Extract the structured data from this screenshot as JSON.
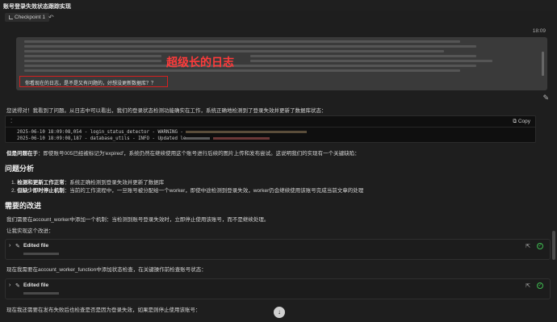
{
  "window": {
    "title": "账号登录失效状态跟踪实现"
  },
  "toolbar": {
    "checkpoint_label": "Checkpoint 1"
  },
  "user_message": {
    "timestamp": "18:09",
    "overlay_label": "超级长的日志",
    "question": "你看现在的日志，是不是又有问题的，好想没更新数据库？？"
  },
  "assistant": {
    "intro": "您说得对！我看到了问题。从日志中可以看出，我们的登录状态检测功能确实在工作，系统正确地检测到了登录失效并更新了数据库状态：",
    "code_copy_label": "Copy",
    "code_lines": [
      {
        "prefix": "2025-06-10 18:09:08,054 - login_status_detector - WARNING - "
      },
      {
        "prefix": "2025-06-10 18:09:08,187 - database_utils - INFO - Updated le"
      }
    ],
    "problem_lead": "但是问题在于",
    "problem_text": "：即使账号005已经被标记为'expired'，系统仍然在继续使用这个账号进行后续的图片上传和发布尝试。这说明我们的实现有一个关键缺陷：",
    "analysis_heading": "问题分析",
    "analysis_items": [
      {
        "num": "1.",
        "lead": "检测和更新工作正常",
        "text": "：系统正确检测到登录失效并更新了数据库"
      },
      {
        "num": "2.",
        "lead": "但缺少即时停止机制",
        "text": "：当前的工作流程中，一旦账号被分配给一个worker，即使中途检测到登录失效，worker仍会继续使用该账号完成当前文章的处理"
      }
    ],
    "improvement_heading": "需要的改进",
    "improvement_text": "我们需要在account_worker中添加一个机制：当检测到账号登录失效时，立即停止使用该账号，而不是继续处理。",
    "implement_text": "让我实现这个改进：",
    "tool_cards": [
      {
        "title": "Edited file"
      },
      {
        "title": "Edited file"
      }
    ],
    "after_first_edit": "现在我需要在account_worker_function中添加状态检查，在关键操作前检查账号状态：",
    "after_second_edit": "现在我还需要在发布失败后也检查是否是因为登录失效，如果是则停止使用该账号："
  }
}
